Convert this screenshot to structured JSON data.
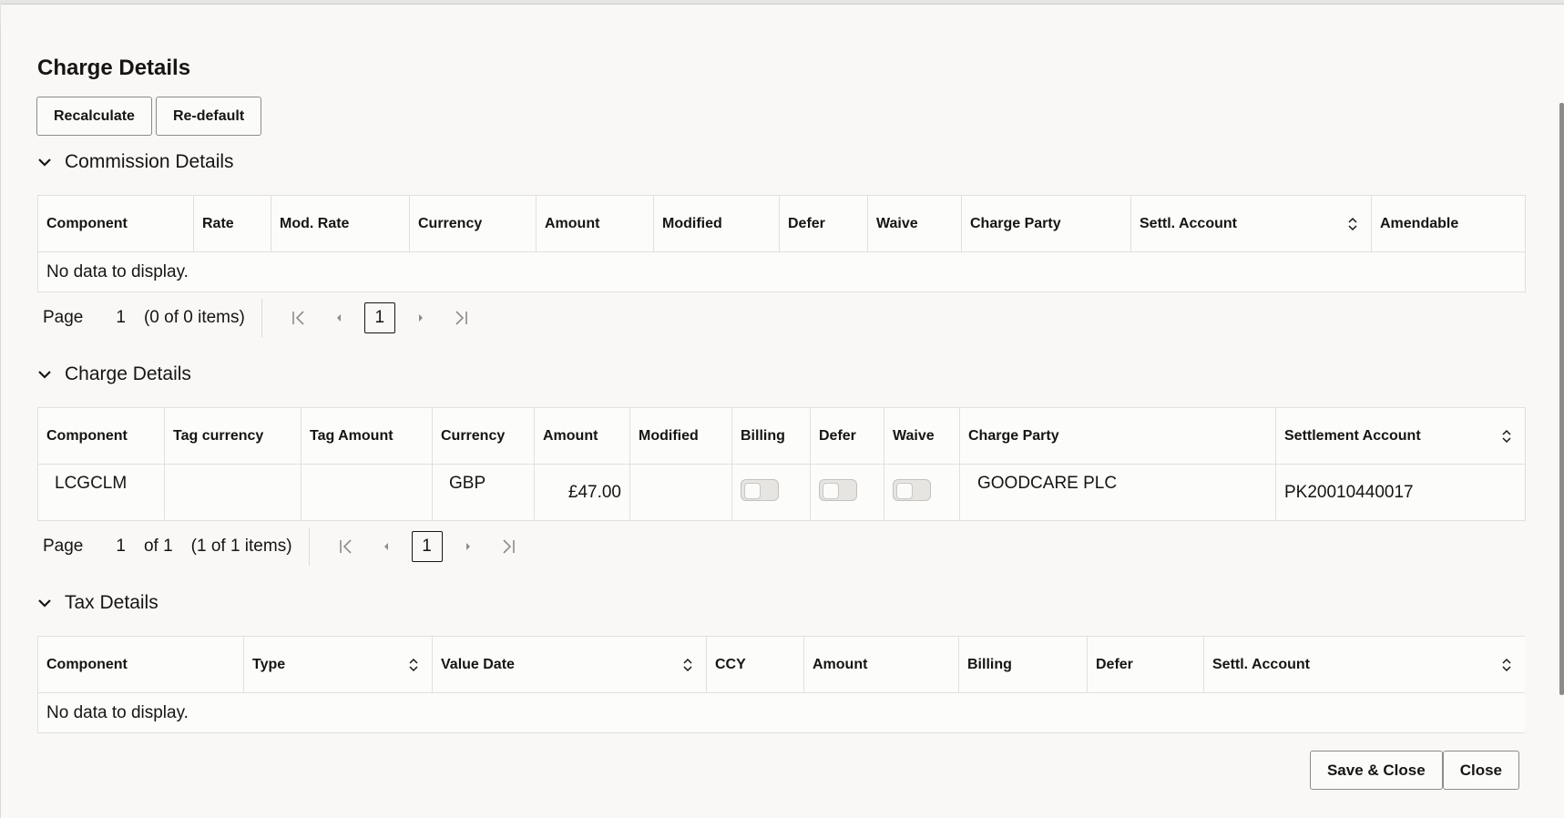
{
  "dialog": {
    "title": "Charge Details",
    "buttons": {
      "recalculate": "Recalculate",
      "redefault": "Re-default"
    },
    "footer": {
      "save_close": "Save & Close",
      "close": "Close"
    }
  },
  "commission": {
    "title": "Commission Details",
    "columns": [
      "Component",
      "Rate",
      "Mod. Rate",
      "Currency",
      "Amount",
      "Modified",
      "Defer",
      "Waive",
      "Charge Party",
      "Settl. Account",
      "Amendable"
    ],
    "empty": "No data to display.",
    "pager": {
      "label": "Page",
      "page": "1",
      "count": "(0 of 0 items)",
      "current": "1"
    }
  },
  "charge": {
    "title": "Charge Details",
    "columns": [
      "Component",
      "Tag currency",
      "Tag Amount",
      "Currency",
      "Amount",
      "Modified",
      "Billing",
      "Defer",
      "Waive",
      "Charge Party",
      "Settlement Account"
    ],
    "rows": [
      {
        "component": "LCGCLM",
        "tag_currency": "",
        "tag_amount": "",
        "currency": "GBP",
        "amount": "£47.00",
        "modified": "",
        "charge_party": "GOODCARE PLC",
        "settlement_account": "PK20010440017"
      }
    ],
    "pager": {
      "label": "Page",
      "page": "1",
      "of": "of 1",
      "count": "(1 of 1 items)",
      "current": "1"
    }
  },
  "tax": {
    "title": "Tax Details",
    "columns": [
      "Component",
      "Type",
      "Value Date",
      "CCY",
      "Amount",
      "Billing",
      "Defer",
      "Settl. Account"
    ],
    "empty": "No data to display."
  }
}
